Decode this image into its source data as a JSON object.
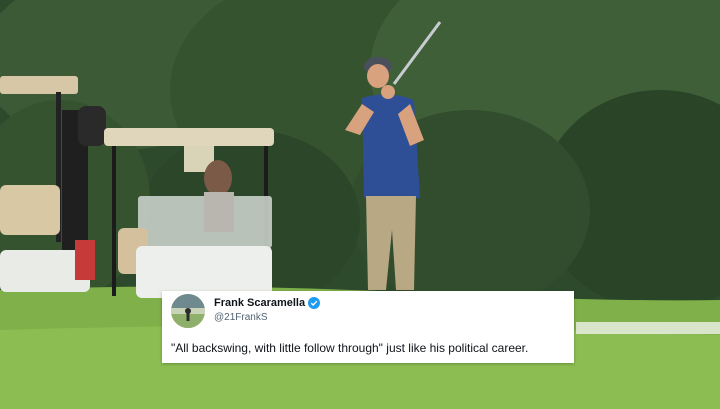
{
  "tweet": {
    "author_name": "Frank Scaramella",
    "author_handle": "@21FrankS",
    "text": "\"All backswing, with little follow through\" just like his political career.",
    "verified": true
  },
  "scene": {
    "icons": [
      "verified-badge-icon",
      "avatar"
    ],
    "colors": {
      "verified": "#1d9bf0",
      "grass": "#7fb04a",
      "trees": "#2f4a2e"
    }
  }
}
